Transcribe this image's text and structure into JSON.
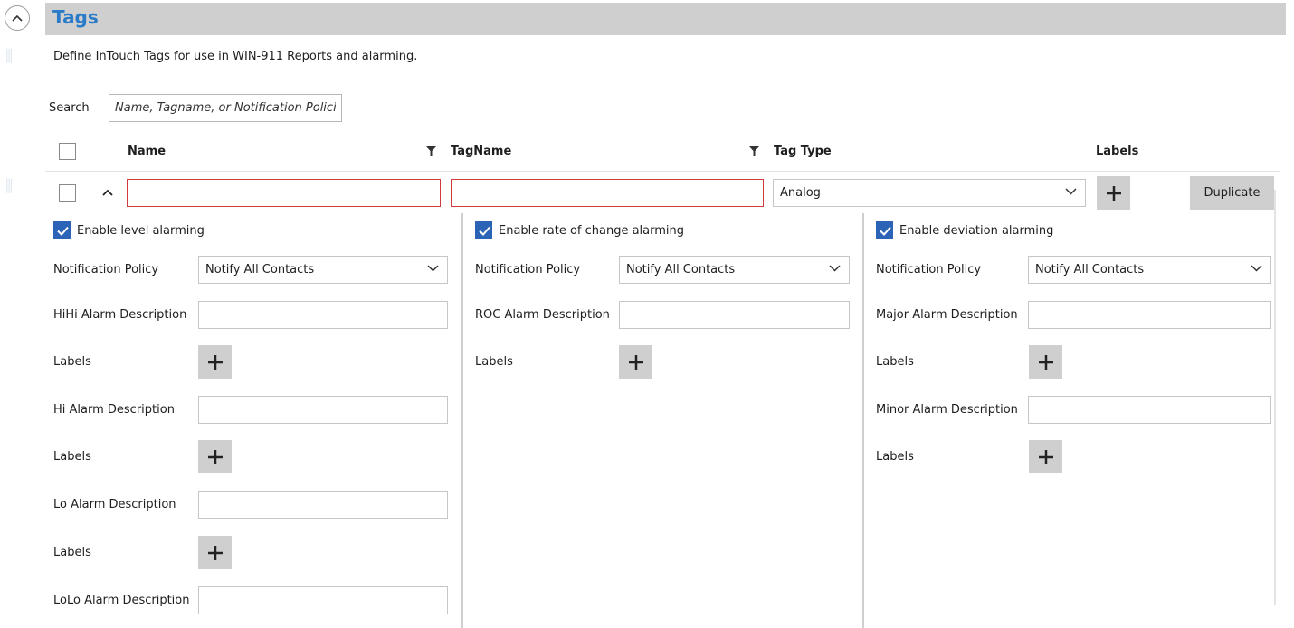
{
  "header": {
    "title": "Tags"
  },
  "description": "Define InTouch Tags for use in WIN-911 Reports and alarming.",
  "search": {
    "label": "Search",
    "placeholder": "Name, Tagname, or Notification Policies"
  },
  "columns": {
    "name": "Name",
    "tagname": "TagName",
    "tag_type": "Tag Type",
    "labels": "Labels"
  },
  "row": {
    "tag_type": "Analog",
    "duplicate_label": "Duplicate"
  },
  "level": {
    "enable_label": "Enable level alarming",
    "policy_label": "Notification Policy",
    "policy_value": "Notify All Contacts",
    "hihi_label": "HiHi Alarm Description",
    "hi_label": "Hi Alarm Description",
    "lo_label": "Lo Alarm Description",
    "lolo_label": "LoLo Alarm Description",
    "labels_label": "Labels"
  },
  "roc": {
    "enable_label": "Enable rate of change alarming",
    "policy_label": "Notification Policy",
    "policy_value": "Notify All Contacts",
    "desc_label": "ROC Alarm Description",
    "labels_label": "Labels"
  },
  "deviation": {
    "enable_label": "Enable deviation alarming",
    "policy_label": "Notification Policy",
    "policy_value": "Notify All Contacts",
    "major_label": "Major Alarm Description",
    "minor_label": "Minor Alarm Description",
    "labels_label": "Labels"
  },
  "colors": {
    "title": "#2a7bc8",
    "checkbox": "#2b63b6",
    "error_border": "#d23b3b",
    "header_bg": "#cfcfcf"
  }
}
